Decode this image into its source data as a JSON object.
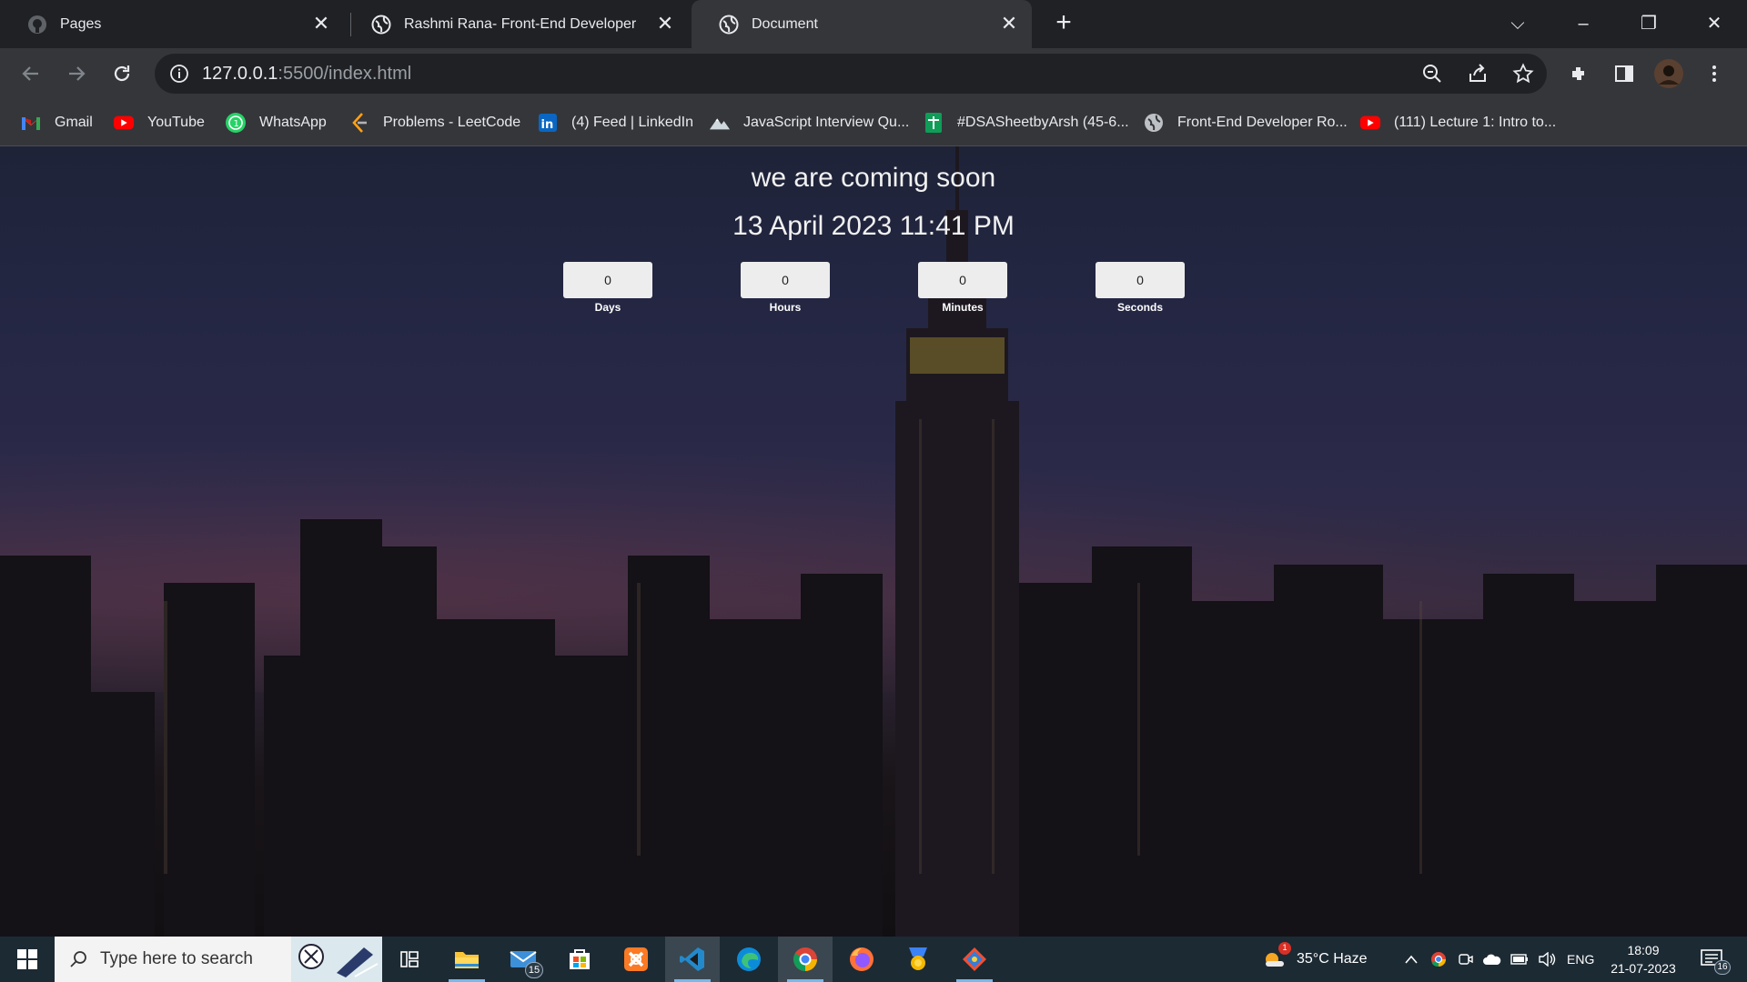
{
  "browser": {
    "tabs": [
      {
        "title": "Pages",
        "icon": "github-icon"
      },
      {
        "title": "Rashmi Rana- Front-End Developer",
        "icon": "globe-icon"
      },
      {
        "title": "Document",
        "icon": "globe-icon",
        "active": true
      }
    ],
    "url": {
      "host": "127.0.0.1",
      "rest": ":5500/index.html"
    },
    "bookmarks": [
      {
        "label": "Gmail",
        "icon": "gmail-icon"
      },
      {
        "label": "YouTube",
        "icon": "youtube-icon"
      },
      {
        "label": "WhatsApp",
        "icon": "whatsapp-icon"
      },
      {
        "label": "Problems - LeetCode",
        "icon": "leetcode-icon"
      },
      {
        "label": "(4) Feed | LinkedIn",
        "icon": "linkedin-icon"
      },
      {
        "label": "JavaScript Interview Qu...",
        "icon": "mountain-icon"
      },
      {
        "label": "#DSASheetbyArsh (45-6...",
        "icon": "sheets-icon"
      },
      {
        "label": "Front-End Developer Ro...",
        "icon": "globe-icon"
      },
      {
        "label": "(111) Lecture 1: Intro to...",
        "icon": "youtube-icon"
      }
    ]
  },
  "page": {
    "heading": "we are coming soon",
    "date": "13 April 2023 11:41 PM",
    "counters": [
      {
        "value": "0",
        "label": "Days"
      },
      {
        "value": "0",
        "label": "Hours"
      },
      {
        "value": "0",
        "label": "Minutes"
      },
      {
        "value": "0",
        "label": "Seconds"
      }
    ]
  },
  "taskbar": {
    "search_placeholder": "Type here to search",
    "mail_badge": "15",
    "weather": "35°C  Haze",
    "weather_badge": "1",
    "language": "ENG",
    "time": "18:09",
    "date": "21-07-2023",
    "notification_count": "16"
  },
  "colors": {
    "tabstrip": "#202124",
    "toolbar": "#35363a",
    "omnibox": "#202124",
    "counter_box": "#ededed",
    "taskbar": "#1c2a33"
  }
}
